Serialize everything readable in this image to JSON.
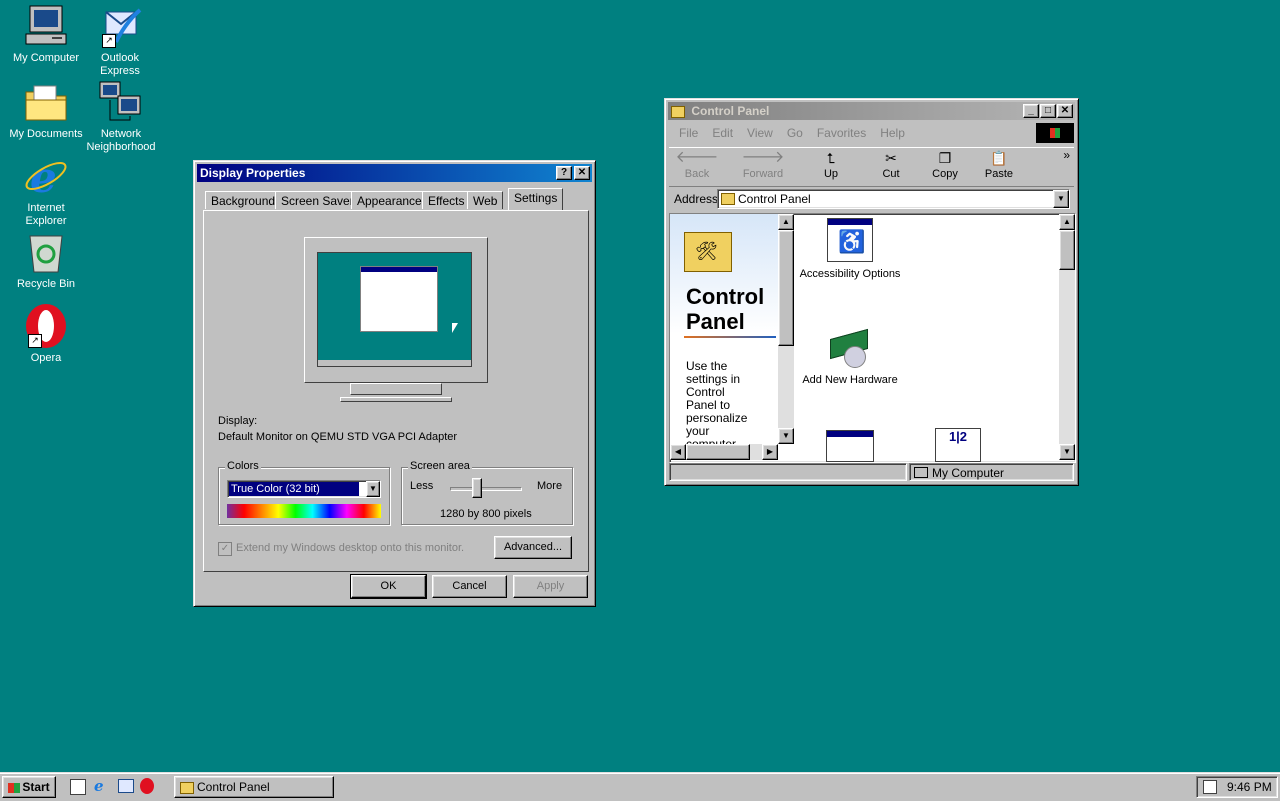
{
  "desktop": {
    "icons": [
      {
        "label": "My Computer",
        "icon": "my-computer-icon"
      },
      {
        "label": "Outlook Express",
        "icon": "outlook-express-icon"
      },
      {
        "label": "My Documents",
        "icon": "my-documents-icon"
      },
      {
        "label": "Network Neighborhood",
        "icon": "network-neighborhood-icon"
      },
      {
        "label": "Internet Explorer",
        "icon": "internet-explorer-icon"
      },
      {
        "label": "Recycle Bin",
        "icon": "recycle-bin-icon"
      },
      {
        "label": "Opera",
        "icon": "opera-icon"
      }
    ],
    "background_color": "#008080"
  },
  "display_properties": {
    "title": "Display Properties",
    "help_glyph": "?",
    "close_glyph": "✕",
    "tabs": [
      "Background",
      "Screen Saver",
      "Appearance",
      "Effects",
      "Web",
      "Settings"
    ],
    "selected_tab": "Settings",
    "display_label": "Display:",
    "display_value": "Default Monitor on QEMU STD VGA PCI Adapter",
    "colors_group": "Colors",
    "colors_value": "True Color (32 bit)",
    "screen_area_group": "Screen area",
    "less_label": "Less",
    "more_label": "More",
    "resolution": "1280 by 800 pixels",
    "extend_checkbox": "Extend my Windows desktop onto this monitor.",
    "advanced_button": "Advanced...",
    "ok_button": "OK",
    "cancel_button": "Cancel",
    "apply_button": "Apply"
  },
  "control_panel": {
    "title": "Control Panel",
    "menu": [
      "File",
      "Edit",
      "View",
      "Go",
      "Favorites",
      "Help"
    ],
    "toolbar": [
      {
        "label": "Back",
        "icon": "back-arrow-icon",
        "enabled": false
      },
      {
        "label": "Forward",
        "icon": "forward-arrow-icon",
        "enabled": false
      },
      {
        "label": "Up",
        "icon": "up-folder-icon",
        "enabled": true
      },
      {
        "label": "Cut",
        "icon": "scissors-icon",
        "enabled": true
      },
      {
        "label": "Copy",
        "icon": "copy-icon",
        "enabled": true
      },
      {
        "label": "Paste",
        "icon": "paste-icon",
        "enabled": true
      }
    ],
    "chevron": "»",
    "address_label": "Address",
    "address_value": "Control Panel",
    "side_title": "Control Panel",
    "side_text": "Use the settings in Control Panel to personalize your computer.",
    "items": [
      {
        "label": "Accessibility Options",
        "icon": "accessibility-icon"
      },
      {
        "label": "Add New Hardware",
        "icon": "add-hardware-icon"
      }
    ],
    "status_text": "My Computer"
  },
  "taskbar": {
    "start_label": "Start",
    "task_label": "Control Panel",
    "clock": "9:46 PM"
  }
}
